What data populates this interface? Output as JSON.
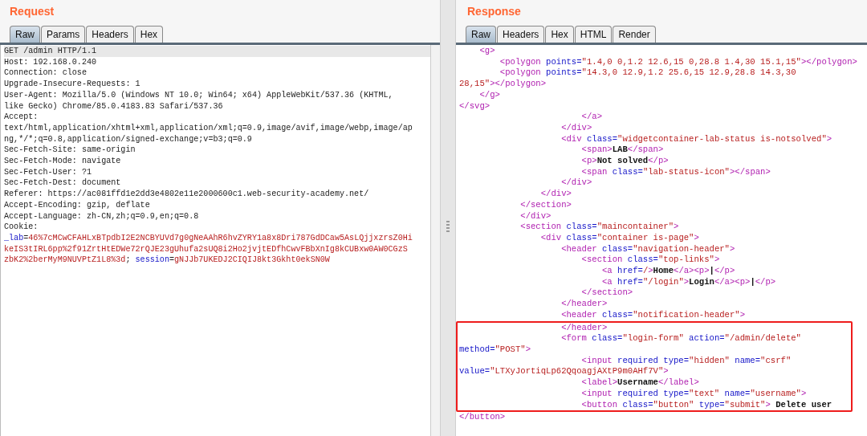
{
  "request": {
    "title": "Request",
    "tabs": [
      {
        "label": "Raw",
        "selected": true
      },
      {
        "label": "Params",
        "selected": false
      },
      {
        "label": "Headers",
        "selected": false
      },
      {
        "label": "Hex",
        "selected": false
      }
    ],
    "lines": [
      {
        "current": true,
        "segs": [
          {
            "kind": "plain",
            "text": "GET /admin HTTP/1.1"
          }
        ]
      },
      {
        "current": false,
        "segs": [
          {
            "kind": "plain",
            "text": "Host: 192.168.0.240"
          }
        ]
      },
      {
        "current": false,
        "segs": [
          {
            "kind": "plain",
            "text": "Connection: close"
          }
        ]
      },
      {
        "current": false,
        "segs": [
          {
            "kind": "plain",
            "text": "Upgrade-Insecure-Requests: 1"
          }
        ]
      },
      {
        "current": false,
        "segs": [
          {
            "kind": "plain",
            "text": "User-Agent: Mozilla/5.0 (Windows NT 10.0; Win64; x64) AppleWebKit/537.36 (KHTML,"
          }
        ]
      },
      {
        "current": false,
        "segs": [
          {
            "kind": "plain",
            "text": "like Gecko) Chrome/85.0.4183.83 Safari/537.36"
          }
        ]
      },
      {
        "current": false,
        "segs": [
          {
            "kind": "plain",
            "text": "Accept:"
          }
        ]
      },
      {
        "current": false,
        "segs": [
          {
            "kind": "plain",
            "text": "text/html,application/xhtml+xml,application/xml;q=0.9,image/avif,image/webp,image/ap"
          }
        ]
      },
      {
        "current": false,
        "segs": [
          {
            "kind": "plain",
            "text": "ng,*/*;q=0.8,application/signed-exchange;v=b3;q=0.9"
          }
        ]
      },
      {
        "current": false,
        "segs": [
          {
            "kind": "plain",
            "text": "Sec-Fetch-Site: same-origin"
          }
        ]
      },
      {
        "current": false,
        "segs": [
          {
            "kind": "plain",
            "text": "Sec-Fetch-Mode: navigate"
          }
        ]
      },
      {
        "current": false,
        "segs": [
          {
            "kind": "plain",
            "text": "Sec-Fetch-User: ?1"
          }
        ]
      },
      {
        "current": false,
        "segs": [
          {
            "kind": "plain",
            "text": "Sec-Fetch-Dest: document"
          }
        ]
      },
      {
        "current": false,
        "segs": [
          {
            "kind": "plain",
            "text": "Referer: https://ac081ffd1e2dd3e4802e11e2000600c1.web-security-academy.net/"
          }
        ]
      },
      {
        "current": false,
        "segs": [
          {
            "kind": "plain",
            "text": "Accept-Encoding: gzip, deflate"
          }
        ]
      },
      {
        "current": false,
        "segs": [
          {
            "kind": "plain",
            "text": "Accept-Language: zh-CN,zh;q=0.9,en;q=0.8"
          }
        ]
      },
      {
        "current": false,
        "segs": [
          {
            "kind": "plain",
            "text": "Cookie:"
          }
        ]
      },
      {
        "current": false,
        "segs": [
          {
            "kind": "attr",
            "text": "_lab"
          },
          {
            "kind": "plain",
            "text": "="
          },
          {
            "kind": "value",
            "text": "46%7cMCwCFAHLxBTpdbI2E2NCBYUVd7g0gNeAAhR6hvZYRY1a8x8Dri787GdDCaw5AsLQjjxzrsZ0Hi"
          }
        ]
      },
      {
        "current": false,
        "segs": [
          {
            "kind": "value",
            "text": "keIS3tIRL6pp%2f91ZrtHtEDWe72rQJE23gUhufa2sUQ8i2Ho2jvjtEDfhCwvFBbXnIg8kCUBxw0AW0CGzS"
          }
        ]
      },
      {
        "current": false,
        "segs": [
          {
            "kind": "value",
            "text": "zbK2%2berMyM9NUVPtZ1L8%3d"
          },
          {
            "kind": "plain",
            "text": "; "
          },
          {
            "kind": "attr",
            "text": "session"
          },
          {
            "kind": "plain",
            "text": "="
          },
          {
            "kind": "value",
            "text": "gNJJb7UKEDJ2CIQIJ8kt3Gkht0ekSN0W"
          }
        ]
      }
    ]
  },
  "response": {
    "title": "Response",
    "tabs": [
      {
        "label": "Raw",
        "selected": true
      },
      {
        "label": "Headers",
        "selected": false
      },
      {
        "label": "Hex",
        "selected": false
      },
      {
        "label": "HTML",
        "selected": false
      },
      {
        "label": "Render",
        "selected": false
      }
    ],
    "lines": [
      {
        "boxed": false,
        "segs": [
          {
            "kind": "tag",
            "text": "    <g>"
          }
        ]
      },
      {
        "boxed": false,
        "segs": [
          {
            "kind": "tag",
            "text": "        <polygon"
          },
          {
            "kind": "attr",
            "text": " points="
          },
          {
            "kind": "value",
            "text": "\"1.4,0 0,1.2 12.6,15 0,28.8 1.4,30 15.1,15\""
          },
          {
            "kind": "tag",
            "text": "></polygon>"
          }
        ]
      },
      {
        "boxed": false,
        "segs": [
          {
            "kind": "tag",
            "text": "        <polygon"
          },
          {
            "kind": "attr",
            "text": " points="
          },
          {
            "kind": "value",
            "text": "\"14.3,0 12.9,1.2 25.6,15 12.9,28.8 14.3,30"
          }
        ]
      },
      {
        "boxed": false,
        "segs": [
          {
            "kind": "value",
            "text": "28,15\""
          },
          {
            "kind": "tag",
            "text": "></polygon>"
          }
        ]
      },
      {
        "boxed": false,
        "segs": [
          {
            "kind": "tag",
            "text": "    </g>"
          }
        ]
      },
      {
        "boxed": false,
        "segs": [
          {
            "kind": "tag",
            "text": "</svg>"
          }
        ]
      },
      {
        "boxed": false,
        "segs": [
          {
            "kind": "tag",
            "text": "                        </a>"
          }
        ]
      },
      {
        "boxed": false,
        "segs": [
          {
            "kind": "tag",
            "text": "                    </div>"
          }
        ]
      },
      {
        "boxed": false,
        "segs": [
          {
            "kind": "tag",
            "text": "                    <div"
          },
          {
            "kind": "attr",
            "text": " class="
          },
          {
            "kind": "value",
            "text": "\"widgetcontainer-lab-status is-notsolved\""
          },
          {
            "kind": "tag",
            "text": ">"
          }
        ]
      },
      {
        "boxed": false,
        "segs": [
          {
            "kind": "tag",
            "text": "                        <span>"
          },
          {
            "kind": "text",
            "text": "LAB"
          },
          {
            "kind": "tag",
            "text": "</span>"
          }
        ]
      },
      {
        "boxed": false,
        "segs": [
          {
            "kind": "tag",
            "text": "                        <p>"
          },
          {
            "kind": "text",
            "text": "Not solved"
          },
          {
            "kind": "tag",
            "text": "</p>"
          }
        ]
      },
      {
        "boxed": false,
        "segs": [
          {
            "kind": "tag",
            "text": "                        <span"
          },
          {
            "kind": "attr",
            "text": " class="
          },
          {
            "kind": "value",
            "text": "\"lab-status-icon\""
          },
          {
            "kind": "tag",
            "text": "></span>"
          }
        ]
      },
      {
        "boxed": false,
        "segs": [
          {
            "kind": "tag",
            "text": "                    </div>"
          }
        ]
      },
      {
        "boxed": false,
        "segs": [
          {
            "kind": "tag",
            "text": "                </div>"
          }
        ]
      },
      {
        "boxed": false,
        "segs": [
          {
            "kind": "tag",
            "text": "            </section>"
          }
        ]
      },
      {
        "boxed": false,
        "segs": [
          {
            "kind": "tag",
            "text": "            </div>"
          }
        ]
      },
      {
        "boxed": false,
        "segs": [
          {
            "kind": "tag",
            "text": "            <section"
          },
          {
            "kind": "attr",
            "text": " class="
          },
          {
            "kind": "value",
            "text": "\"maincontainer\""
          },
          {
            "kind": "tag",
            "text": ">"
          }
        ]
      },
      {
        "boxed": false,
        "segs": [
          {
            "kind": "tag",
            "text": "                <div"
          },
          {
            "kind": "attr",
            "text": " class="
          },
          {
            "kind": "value",
            "text": "\"container is-page\""
          },
          {
            "kind": "tag",
            "text": ">"
          }
        ]
      },
      {
        "boxed": false,
        "segs": [
          {
            "kind": "tag",
            "text": "                    <header"
          },
          {
            "kind": "attr",
            "text": " class="
          },
          {
            "kind": "value",
            "text": "\"navigation-header\""
          },
          {
            "kind": "tag",
            "text": ">"
          }
        ]
      },
      {
        "boxed": false,
        "segs": [
          {
            "kind": "tag",
            "text": "                        <section"
          },
          {
            "kind": "attr",
            "text": " class="
          },
          {
            "kind": "value",
            "text": "\"top-links\""
          },
          {
            "kind": "tag",
            "text": ">"
          }
        ]
      },
      {
        "boxed": false,
        "segs": [
          {
            "kind": "tag",
            "text": "                            <a"
          },
          {
            "kind": "attr",
            "text": " href="
          },
          {
            "kind": "value",
            "text": "/"
          },
          {
            "kind": "tag",
            "text": ">"
          },
          {
            "kind": "text",
            "text": "Home"
          },
          {
            "kind": "tag",
            "text": "</a><p>"
          },
          {
            "kind": "text",
            "text": "|"
          },
          {
            "kind": "tag",
            "text": "</p>"
          }
        ]
      },
      {
        "boxed": false,
        "segs": [
          {
            "kind": "tag",
            "text": "                            <a"
          },
          {
            "kind": "attr",
            "text": " href="
          },
          {
            "kind": "value",
            "text": "\"/login\""
          },
          {
            "kind": "tag",
            "text": ">"
          },
          {
            "kind": "text",
            "text": "Login"
          },
          {
            "kind": "tag",
            "text": "</a><p>"
          },
          {
            "kind": "text",
            "text": "|"
          },
          {
            "kind": "tag",
            "text": "</p>"
          }
        ]
      },
      {
        "boxed": false,
        "segs": [
          {
            "kind": "tag",
            "text": "                        </section>"
          }
        ]
      },
      {
        "boxed": false,
        "segs": [
          {
            "kind": "tag",
            "text": "                    </header>"
          }
        ]
      },
      {
        "boxed": false,
        "segs": [
          {
            "kind": "tag",
            "text": "                    <header"
          },
          {
            "kind": "attr",
            "text": " class="
          },
          {
            "kind": "value",
            "text": "\"notification-header\""
          },
          {
            "kind": "tag",
            "text": ">"
          }
        ]
      },
      {
        "boxed": true,
        "segs": [
          {
            "kind": "tag",
            "text": "                    </header>"
          }
        ]
      },
      {
        "boxed": true,
        "segs": [
          {
            "kind": "tag",
            "text": "                    <form"
          },
          {
            "kind": "attr",
            "text": " class="
          },
          {
            "kind": "value",
            "text": "\"login-form\""
          },
          {
            "kind": "attr",
            "text": " action="
          },
          {
            "kind": "value",
            "text": "\"/admin/delete\""
          }
        ]
      },
      {
        "boxed": true,
        "segs": [
          {
            "kind": "attr",
            "text": "method="
          },
          {
            "kind": "value",
            "text": "\"POST\""
          },
          {
            "kind": "tag",
            "text": ">"
          }
        ]
      },
      {
        "boxed": true,
        "segs": [
          {
            "kind": "tag",
            "text": "                        <input"
          },
          {
            "kind": "attr",
            "text": " required type="
          },
          {
            "kind": "value",
            "text": "\"hidden\""
          },
          {
            "kind": "attr",
            "text": " name="
          },
          {
            "kind": "value",
            "text": "\"csrf\""
          }
        ]
      },
      {
        "boxed": true,
        "segs": [
          {
            "kind": "attr",
            "text": "value="
          },
          {
            "kind": "value",
            "text": "\"LTXyJortiqLp62QqoagjAXtP9m0AHf7V\""
          },
          {
            "kind": "tag",
            "text": ">"
          }
        ]
      },
      {
        "boxed": true,
        "segs": [
          {
            "kind": "tag",
            "text": "                        <label>"
          },
          {
            "kind": "text",
            "text": "Username"
          },
          {
            "kind": "tag",
            "text": "</label>"
          }
        ]
      },
      {
        "boxed": true,
        "segs": [
          {
            "kind": "tag",
            "text": "                        <input"
          },
          {
            "kind": "attr",
            "text": " required type="
          },
          {
            "kind": "value",
            "text": "\"text\""
          },
          {
            "kind": "attr",
            "text": " name="
          },
          {
            "kind": "value",
            "text": "\"username\""
          },
          {
            "kind": "tag",
            "text": ">"
          }
        ]
      },
      {
        "boxed": true,
        "segs": [
          {
            "kind": "tag",
            "text": "                        <button"
          },
          {
            "kind": "attr",
            "text": " class="
          },
          {
            "kind": "value",
            "text": "\"button\""
          },
          {
            "kind": "attr",
            "text": " type="
          },
          {
            "kind": "value",
            "text": "\"submit\""
          },
          {
            "kind": "tag",
            "text": ">"
          },
          {
            "kind": "text",
            "text": " Delete user"
          }
        ]
      },
      {
        "boxed": false,
        "segs": [
          {
            "kind": "tag",
            "text": "</button>"
          }
        ]
      }
    ]
  }
}
